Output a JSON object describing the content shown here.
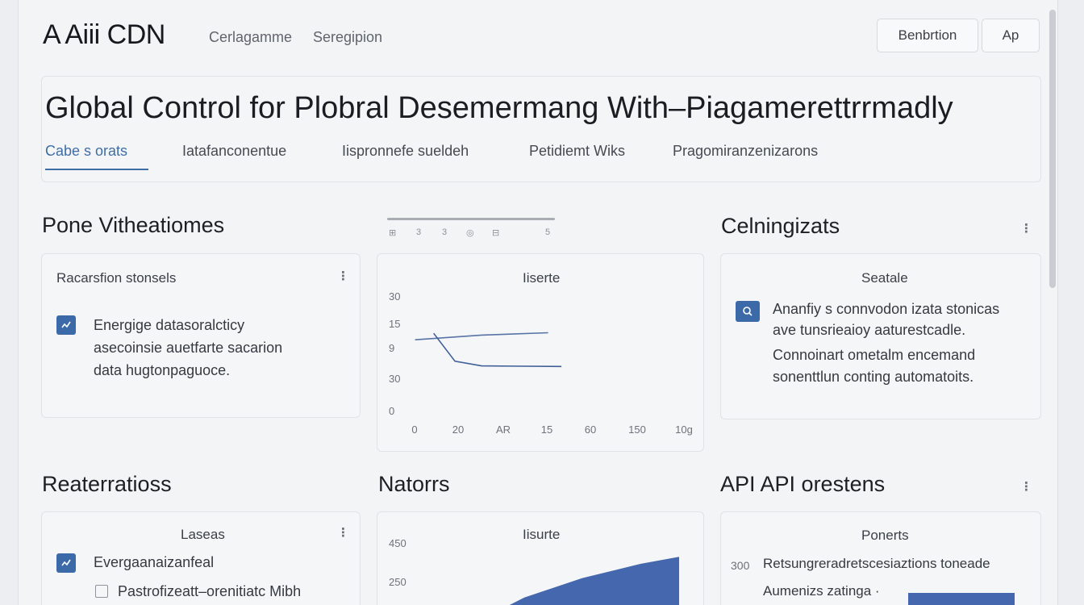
{
  "header": {
    "logo": "A Aiii CDN",
    "nav": [
      "Cerlagamme",
      "Seregipion"
    ],
    "buttons": [
      "Benbrtion",
      "Ap"
    ]
  },
  "hero": {
    "title": "Global Control for Plobral Desemermang With–Piagamerettrrmadly",
    "tabs": [
      "Cabe s orats",
      "Iatafanconentue",
      "Iispronnefe sueldeh",
      "Petidiemt Wiks",
      "Pragomiranzenizarons"
    ],
    "active_tab": 0
  },
  "sections": {
    "top_left": {
      "title": "Pone Vitheatiomes",
      "card_head": "Racarsfion stonsels",
      "lines": [
        "Energige datasoralcticy",
        "asecoinsie auetfarte sacarion",
        "data hugtonpaguoce."
      ]
    },
    "top_middle": {
      "mini_ticks": [
        "⊞",
        "3",
        "3",
        "◎",
        "⊟",
        "5"
      ],
      "chart_head": "Iiserte"
    },
    "top_right": {
      "title": "Celningizats",
      "card_head": "Seatale",
      "lines": [
        "Ananfiy s connvodon izata stonicas",
        "ave tunsrieaioy aaturestcadle.",
        "Connoinart ometalm encemand",
        "sonenttlun conting automatoits."
      ]
    },
    "bottom_left": {
      "title": "Reaterratioss",
      "card_head": "Laseas",
      "item1": "Evergaanaizanfeal",
      "item2": "Pastrofizeatt–orenitiatc Mibh"
    },
    "bottom_middle": {
      "title": "Natorrs",
      "chart_head": "Iisurte"
    },
    "bottom_right": {
      "title": "API API orestens",
      "card_head": "Ponerts",
      "row1_value": "300",
      "row1_label": "Retsungreradretscesiaztions toneade",
      "row2_label": "Aumenizs zatinga ·"
    }
  },
  "chart_data": [
    {
      "type": "line",
      "title": "Iiserte",
      "y_ticks": [
        "30",
        "15",
        "9",
        "30",
        "0"
      ],
      "x_ticks": [
        "0",
        "20",
        "AR",
        "15",
        "60",
        "150",
        "10g"
      ],
      "series": [
        {
          "values": [
            [
              2,
              12.2
            ],
            [
              27,
              13.0
            ],
            [
              52,
              13.4
            ]
          ]
        },
        {
          "values": [
            [
              9,
              13.3
            ],
            [
              17,
              8.5
            ],
            [
              27,
              7.7
            ],
            [
              57,
              7.6
            ]
          ]
        }
      ],
      "colors": [
        "#5873a6",
        "#3f5e98"
      ]
    },
    {
      "type": "area",
      "title": "Iisurte",
      "y_ticks": [
        "450",
        "250"
      ],
      "series": [
        {
          "values": [
            [
              0,
              0
            ],
            [
              20,
              55
            ],
            [
              50,
              110
            ],
            [
              80,
              150
            ],
            [
              100,
              170
            ]
          ]
        }
      ],
      "color": "#4467ad"
    }
  ]
}
